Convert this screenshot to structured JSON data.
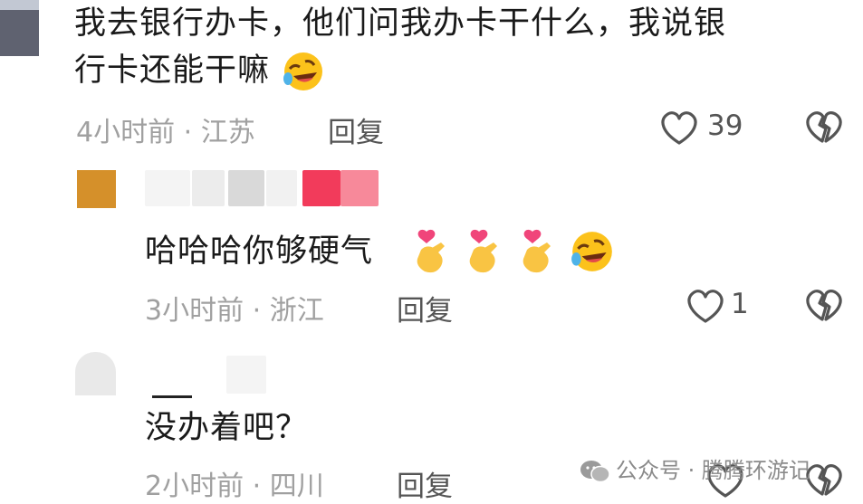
{
  "comments": [
    {
      "text_line1": "我去银行办卡，他们问我办卡干什么，我说银",
      "text_line2": "行卡还能干嘛",
      "time": "4小时前",
      "location": "江苏",
      "reply_label": "回复",
      "likes": "39"
    },
    {
      "text": "哈哈哈你够硬气",
      "time": "3小时前",
      "location": "浙江",
      "reply_label": "回复",
      "likes": "1"
    },
    {
      "text": "没办着吧？",
      "time": "2小时前",
      "location": "四川",
      "reply_label": "回复"
    }
  ],
  "separator": " · ",
  "watermark": {
    "text": "公众号 · 腾腾环游记"
  },
  "icons": {
    "like": "heart-outline-icon",
    "dislike": "broken-heart-icon",
    "emoji_laugh": "rolling-laughing-emoji",
    "emoji_heart_hand": "finger-heart-emoji"
  },
  "colors": {
    "meta_text": "#a0a0a0",
    "icon_stroke": "#555555",
    "avatar_orange": "#d5902a",
    "name_pink": "#f23b5b"
  }
}
